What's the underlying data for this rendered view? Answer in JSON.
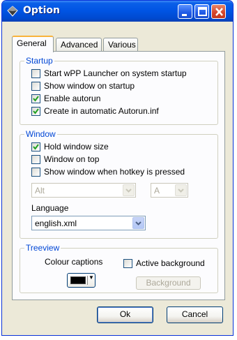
{
  "window": {
    "title": "Option",
    "icons": {
      "app": "app-diamond-icon",
      "minimize": "minimize-icon",
      "maximize": "maximize-icon",
      "close": "close-icon"
    }
  },
  "tabs": [
    {
      "label": "General",
      "active": true
    },
    {
      "label": "Advanced",
      "active": false
    },
    {
      "label": "Various",
      "active": false
    }
  ],
  "startup": {
    "title": "Startup",
    "options": [
      {
        "label": "Start wPP Launcher on system startup",
        "checked": false
      },
      {
        "label": "Show window on startup",
        "checked": false
      },
      {
        "label": "Enable autorun",
        "checked": true
      },
      {
        "label": "Create in automatic Autorun.inf",
        "checked": true
      }
    ]
  },
  "window_group": {
    "title": "Window",
    "options": [
      {
        "label": "Hold window size",
        "checked": true
      },
      {
        "label": "Window on top",
        "checked": false
      },
      {
        "label": "Show window when hotkey is pressed",
        "checked": false
      }
    ],
    "modifier_select": {
      "value": "Alt",
      "disabled": true
    },
    "key_select": {
      "value": "A",
      "disabled": true
    },
    "language_label": "Language",
    "language_select": {
      "value": "english.xml"
    }
  },
  "treeview": {
    "title": "Treeview",
    "colour_captions_label": "Colour captions",
    "colour_value": "#000000",
    "active_background": {
      "label": "Active background",
      "checked": false
    },
    "background_button": "Background"
  },
  "buttons": {
    "ok": "Ok",
    "cancel": "Cancel"
  },
  "colors": {
    "accent": "#0054e3",
    "group_title": "#0046d5",
    "check": "#21a121"
  }
}
